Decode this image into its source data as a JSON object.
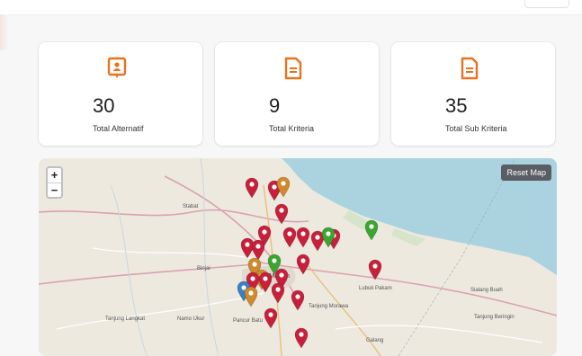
{
  "cards": [
    {
      "value": "30",
      "label": "Total Alternatif",
      "icon": "person-board-icon"
    },
    {
      "value": "9",
      "label": "Total Kriteria",
      "icon": "document-icon"
    },
    {
      "value": "35",
      "label": "Total Sub Kriteria",
      "icon": "document-icon"
    }
  ],
  "map": {
    "zoom_in": "+",
    "zoom_out": "−",
    "reset_label": "Reset Map",
    "places": {
      "stabat": "Stabat",
      "binjai": "Binjai",
      "medan": "Medan",
      "tanjung_langkat": "Tanjung Langkat",
      "namo_ukur": "Namo Ukur",
      "pancur_batu": "Pancur Batu",
      "tanjung_morawa": "Tanjung Morawa",
      "lubuk_pakam": "Lubuk Pakam",
      "galang": "Galang",
      "sialang_buah": "Sialang Buah",
      "tanjung_beringin": "Tanjung Beringin"
    }
  },
  "colors": {
    "accent": "#e8731e",
    "marker_red": "#c8203a",
    "marker_orange": "#cf8a2c",
    "marker_green": "#3aa52f",
    "marker_blue": "#3b7fc4",
    "sea": "#aad3df",
    "reset_bg": "#5a5d63"
  }
}
